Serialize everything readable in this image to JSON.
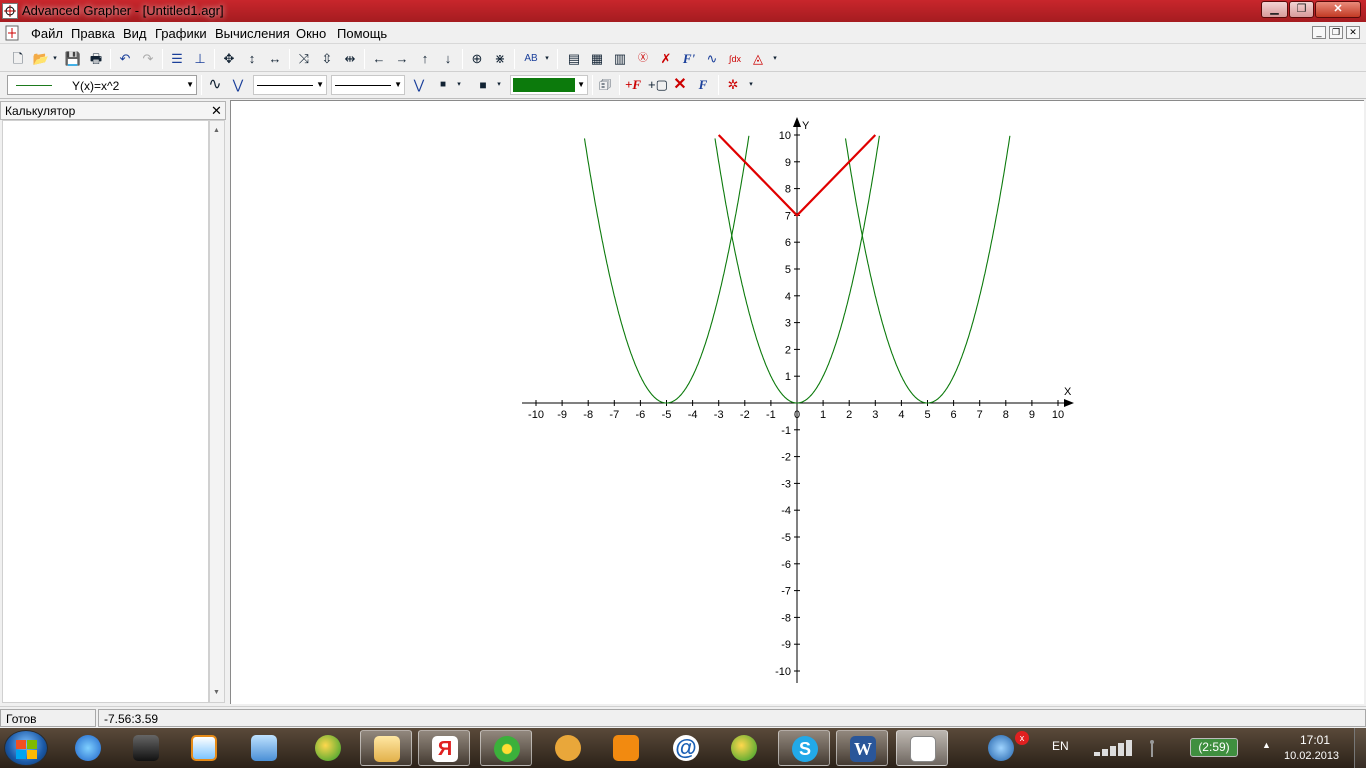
{
  "window": {
    "title": "Advanced Grapher - [Untitled1.agr]"
  },
  "menu": [
    "Файл",
    "Правка",
    "Вид",
    "Графики",
    "Вычисления",
    "Окно",
    "Помощь"
  ],
  "toolbar2": {
    "function_label": "Y(x)=x^2",
    "color": "#0c7a0c"
  },
  "panel": {
    "title": "Калькулятор"
  },
  "status": {
    "left": "Готов",
    "coords": "-7.56:3.59"
  },
  "tray": {
    "lang": "EN",
    "battery": "(2:59)",
    "time": "17:01",
    "date": "10.02.2013"
  },
  "chart_data": {
    "type": "line",
    "xlabel": "X",
    "ylabel": "Y",
    "xlim": [
      -10,
      10
    ],
    "ylim": [
      -10,
      10
    ],
    "grid": false,
    "x_ticks": [
      -10,
      -9,
      -8,
      -7,
      -6,
      -5,
      -4,
      -3,
      -2,
      -1,
      0,
      1,
      2,
      3,
      4,
      5,
      6,
      7,
      8,
      9,
      10
    ],
    "y_ticks": [
      -10,
      -9,
      -8,
      -7,
      -6,
      -5,
      -4,
      -3,
      -2,
      -1,
      0,
      1,
      2,
      3,
      4,
      5,
      6,
      7,
      8,
      9,
      10
    ],
    "series": [
      {
        "expr": "Y(x)=x^2",
        "shift": 0,
        "color": "#0c7a0c"
      },
      {
        "shift": -5,
        "color": "#0c7a0c"
      },
      {
        "shift": 5,
        "color": "#0c7a0c"
      },
      {
        "type": "polyline",
        "color": "#e00000",
        "x": [
          -3,
          0,
          3
        ],
        "y": [
          10,
          7,
          10
        ]
      }
    ]
  }
}
